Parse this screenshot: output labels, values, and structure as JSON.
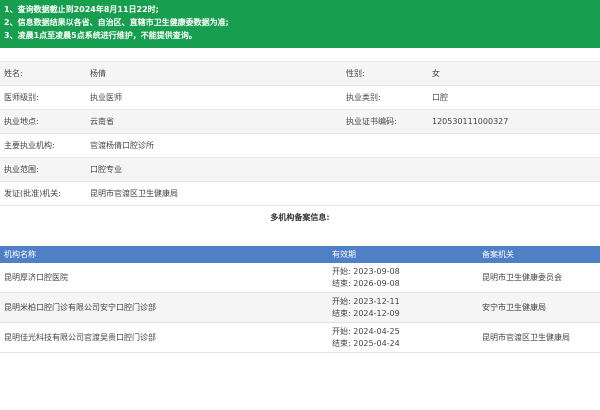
{
  "notices": [
    "1、查询数据截止到2024年8月11日22时;",
    "2、信息数据结果以各省、自治区、直辖市卫生健康委数据为准;",
    "3、凌晨1点至凌晨5点系统进行维护，不能提供查询。"
  ],
  "info_rows": [
    {
      "label1": "姓名:",
      "value1": "杨倩",
      "label2": "性别:",
      "value2": "女"
    },
    {
      "label1": "医师级别:",
      "value1": "执业医师",
      "label2": "执业类别:",
      "value2": "口腔"
    },
    {
      "label1": "执业地点:",
      "value1": "云南省",
      "label2": "执业证书编码:",
      "value2": "120530111000327"
    },
    {
      "label1": "主要执业机构:",
      "value1": "官渡杨倩口腔诊所",
      "label2": "",
      "value2": ""
    },
    {
      "label1": "执业范围:",
      "value1": "口腔专业",
      "label2": "",
      "value2": ""
    },
    {
      "label1": "发证(批准)机关:",
      "value1": "昆明市官渡区卫生健康局",
      "label2": "",
      "value2": ""
    }
  ],
  "multi_title": "多机构备案信息:",
  "table": {
    "headers": [
      "机构名称",
      "有效期",
      "备案机关"
    ],
    "rows": [
      {
        "name": "昆明厚济口腔医院",
        "start": "开始: 2023-09-08",
        "end": "结束: 2026-09-08",
        "authority": "昆明市卫生健康委员会"
      },
      {
        "name": "昆明米柏口腔门诊有限公司安宁口腔门诊部",
        "start": "开始: 2023-12-11",
        "end": "结束: 2024-12-09",
        "authority": "安宁市卫生健康局"
      },
      {
        "name": "昆明佳光科技有限公司官渡吴贵口腔门诊部",
        "start": "开始: 2024-04-25",
        "end": "结束: 2025-04-24",
        "authority": "昆明市官渡区卫生健康局"
      }
    ]
  },
  "colors": {
    "notice_bg": "#179f4f",
    "table_header_bg": "#4f80c6",
    "alt_row_bg": "#f5f5f5"
  }
}
